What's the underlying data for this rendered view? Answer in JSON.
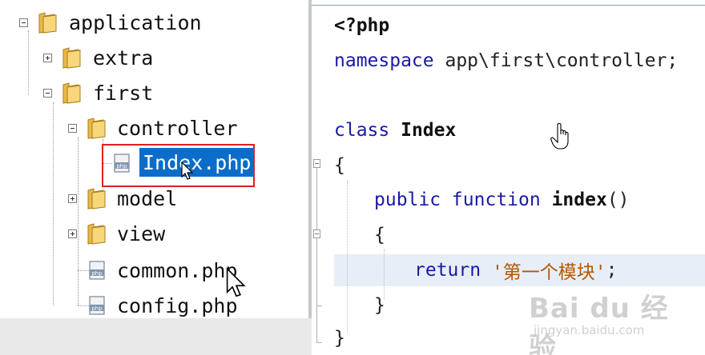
{
  "file_tree": {
    "root": {
      "label": "application",
      "expanded": true,
      "icon": "folder-icon"
    },
    "items": [
      {
        "label": "extra",
        "expanded": false,
        "icon": "folder-icon"
      },
      {
        "label": "first",
        "expanded": true,
        "icon": "folder-icon"
      },
      {
        "label": "controller",
        "expanded": true,
        "icon": "folder-icon"
      },
      {
        "label": "Index.php",
        "selected": true,
        "icon": "php-file-icon"
      },
      {
        "label": "model",
        "expanded": false,
        "icon": "folder-icon"
      },
      {
        "label": "view",
        "expanded": false,
        "icon": "folder-icon"
      },
      {
        "label": "common.php",
        "icon": "php-file-icon"
      },
      {
        "label": "config.php",
        "icon": "php-file-icon"
      }
    ],
    "selection_color": "#0b6dc9",
    "highlight_box_color": "#e02020"
  },
  "code": {
    "open_tag": "<?php",
    "ns_keyword": "namespace",
    "ns_value": " app\\first\\controller;",
    "class_keyword": "class",
    "class_name": " Index",
    "brace_open": "{",
    "method_modifiers": "public function",
    "method_name": " index",
    "method_parens": "()",
    "method_brace_open": "{",
    "return_keyword": "return",
    "return_string": " '第一个模块'",
    "return_semicolon": ";",
    "method_brace_close": "}",
    "brace_close": "}",
    "keyword_color": "#1a1aa6",
    "string_color": "#b35a00",
    "current_line_color": "#e8eef7"
  },
  "watermark": {
    "main": "Bai du 经验",
    "sub": "jingyan.baidu.com"
  }
}
